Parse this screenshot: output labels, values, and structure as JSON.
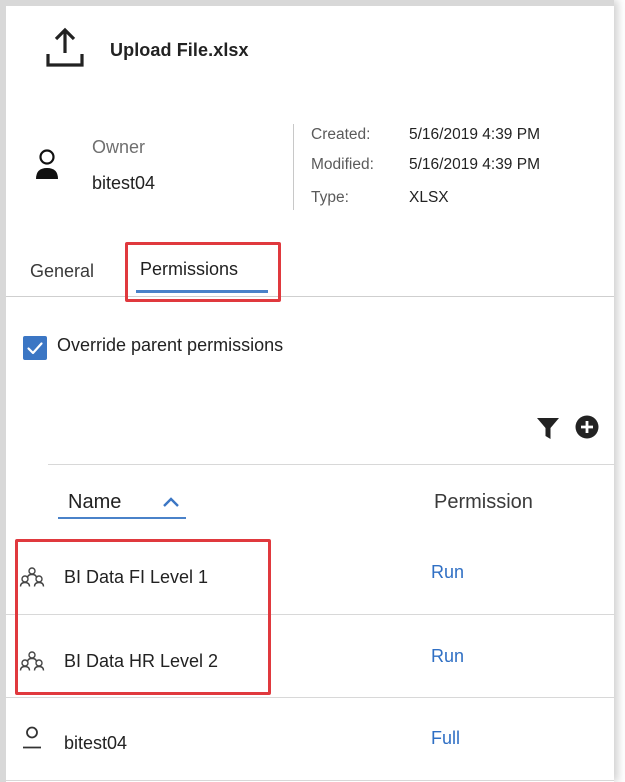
{
  "header": {
    "title": "Upload File.xlsx",
    "icon": "upload-icon"
  },
  "owner": {
    "label": "Owner",
    "name": "bitest04",
    "icon": "user-icon"
  },
  "meta": {
    "created_label": "Created:",
    "created_value": "5/16/2019 4:39 PM",
    "modified_label": "Modified:",
    "modified_value": "5/16/2019 4:39 PM",
    "type_label": "Type:",
    "type_value": "XLSX"
  },
  "tabs": [
    {
      "label": "General",
      "active": false
    },
    {
      "label": "Permissions",
      "active": true
    }
  ],
  "override": {
    "label": "Override parent permissions",
    "checked": true
  },
  "toolbar": {
    "filter_icon": "filter-icon",
    "add_icon": "add-circle-icon"
  },
  "table": {
    "columns": {
      "name": "Name",
      "permission": "Permission"
    },
    "sort": {
      "column": "Name",
      "direction": "ascending"
    },
    "rows": [
      {
        "name": "BI Data FI Level 1",
        "permission": "Run",
        "icon": "group-icon"
      },
      {
        "name": "BI Data HR Level 2",
        "permission": "Run",
        "icon": "group-icon"
      },
      {
        "name": "bitest04",
        "permission": "Full",
        "icon": "user-icon"
      }
    ]
  },
  "colors": {
    "accent": "#4a82c9",
    "link": "#2f6fc4",
    "checkbox": "#3b76c4",
    "highlight": "#e0393e"
  }
}
